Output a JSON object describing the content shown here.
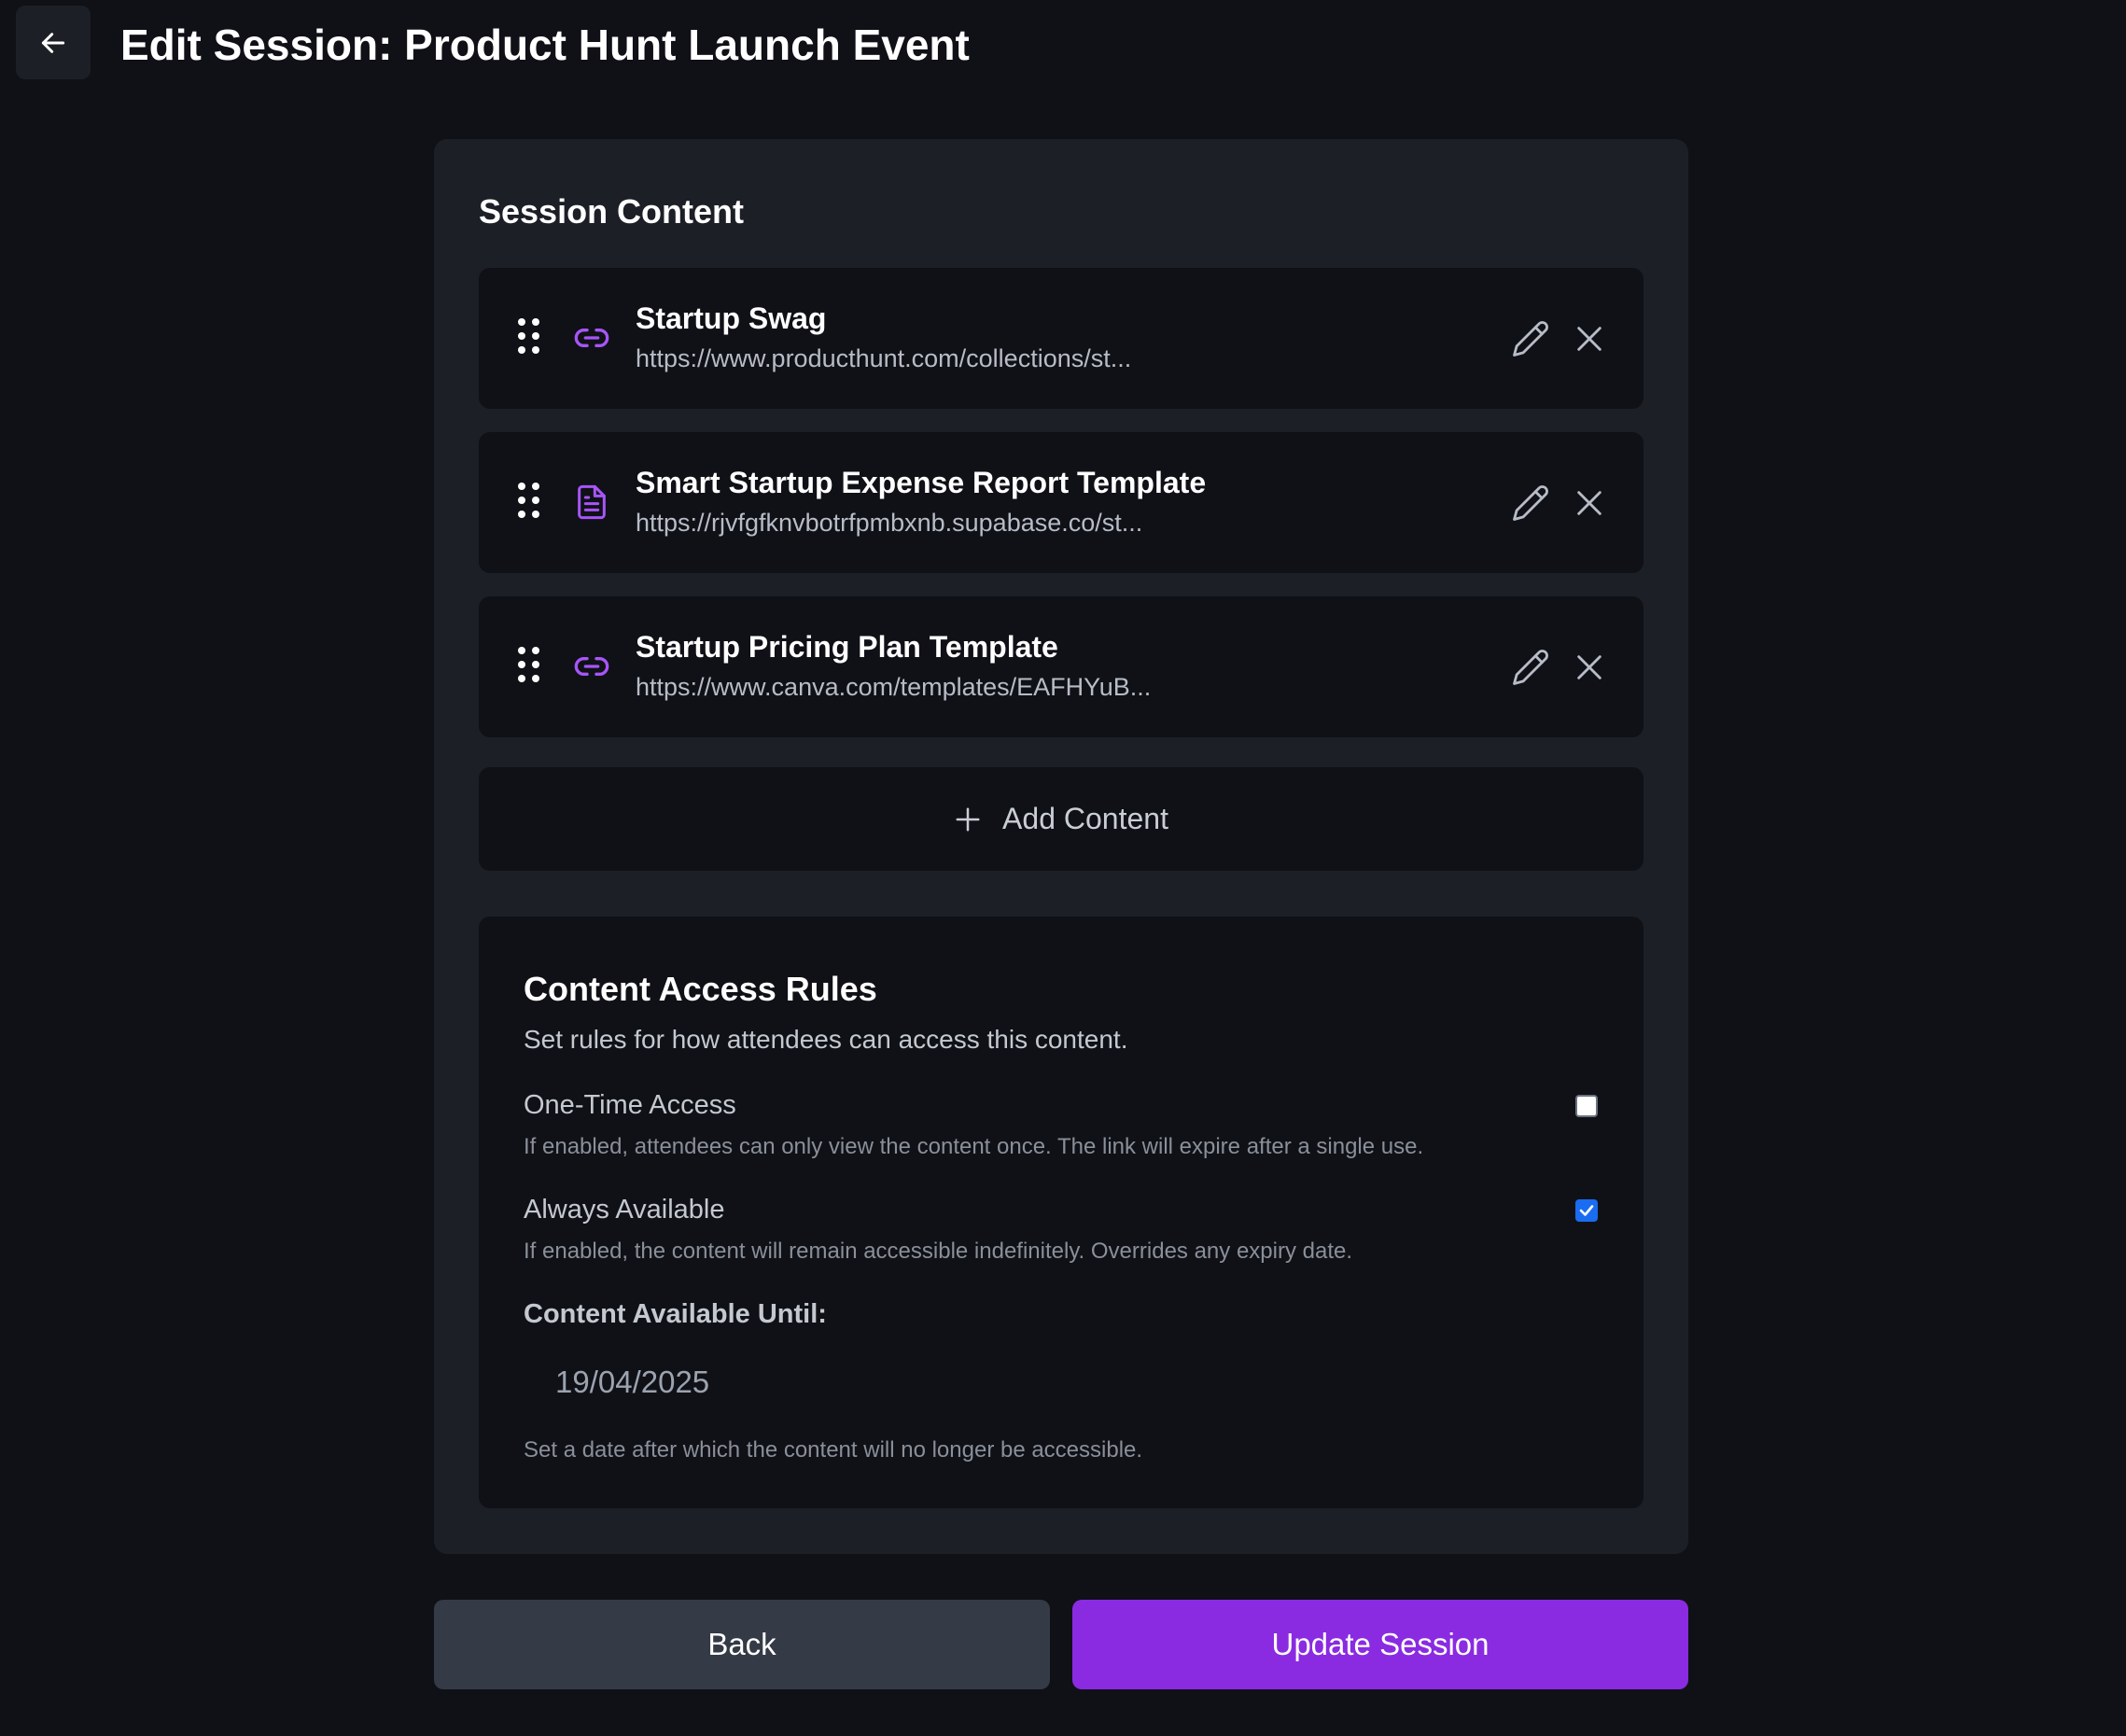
{
  "header": {
    "title": "Edit Session: Product Hunt Launch Event",
    "back_icon": "arrow-left-icon"
  },
  "session_content": {
    "title": "Session Content",
    "items": [
      {
        "title": "Startup Swag",
        "url": "https://www.producthunt.com/collections/st...",
        "icon": "link-icon"
      },
      {
        "title": "Smart Startup Expense Report Template",
        "url": "https://rjvfgfknvbotrfpmbxnb.supabase.co/st...",
        "icon": "document-icon"
      },
      {
        "title": "Startup Pricing Plan Template",
        "url": "https://www.canva.com/templates/EAFHYuB...",
        "icon": "link-icon"
      }
    ],
    "add_label": "Add Content"
  },
  "access_rules": {
    "title": "Content Access Rules",
    "description": "Set rules for how attendees can access this content.",
    "one_time": {
      "label": "One-Time Access",
      "help": "If enabled, attendees can only view the content once. The link will expire after a single use.",
      "checked": false
    },
    "always_available": {
      "label": "Always Available",
      "help": "If enabled, the content will remain accessible indefinitely. Overrides any expiry date.",
      "checked": true
    },
    "until_label": "Content Available Until:",
    "until_value": "19/04/2025",
    "until_help": "Set a date after which the content will no longer be accessible."
  },
  "footer": {
    "back_label": "Back",
    "update_label": "Update Session"
  },
  "colors": {
    "background": "#0f1117",
    "card": "#1c1f26",
    "accent": "#8a2be2",
    "icon_accent": "#a855f7",
    "checkbox_on": "#1a6cf0",
    "secondary_button": "#343a46"
  }
}
